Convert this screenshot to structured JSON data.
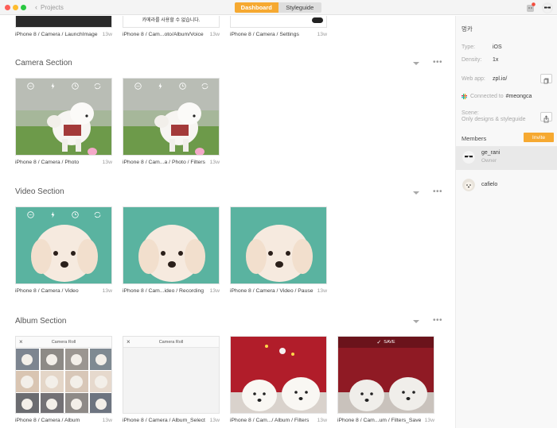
{
  "titlebar": {
    "back_label": "Projects",
    "tabs": [
      "Dashboard",
      "Styleguide"
    ],
    "active_tab": "Dashboard",
    "accent": "#f6a931"
  },
  "partial_row": [
    {
      "name": "iPhone 8 / Camera / LaunchImage",
      "time": "13w"
    },
    {
      "name": "iPhone 8 / Cam...oto/Album/Voice",
      "time": "13w",
      "overlay_text": "카메라를 사용할 수 없습니다."
    },
    {
      "name": "iPhone 8 / Camera / Settings",
      "time": "13w"
    }
  ],
  "sections": [
    {
      "title": "Camera Section",
      "cards": [
        {
          "name": "iPhone 8 / Camera / Photo",
          "time": "13w"
        },
        {
          "name": "iPhone 8 / Cam...a / Photo / Filters",
          "time": "13w"
        }
      ]
    },
    {
      "title": "Video Section",
      "cards": [
        {
          "name": "iPhone 8 / Camera / Video",
          "time": "13w"
        },
        {
          "name": "iPhone 8 / Cam...ideo / Recording",
          "time": "13w"
        },
        {
          "name": "iPhone 8 / Camera / Video / Pause",
          "time": "13w"
        }
      ]
    },
    {
      "title": "Album Section",
      "cards": [
        {
          "name": "iPhone 8 / Camera / Album",
          "time": "13w",
          "header": "Camera Roll"
        },
        {
          "name": "iPhone 8 / Camera / Album_Select",
          "time": "13w",
          "header": "Camera Roll"
        },
        {
          "name": "iPhone 8 / Cam.../ Album / Filters",
          "time": "13w"
        },
        {
          "name": "iPhone 8 / Cam...um / Filters_Save",
          "time": "13w",
          "header": "SAVE"
        }
      ]
    }
  ],
  "sidebar": {
    "project_name": "멍카",
    "type_label": "Type:",
    "type_value": "iOS",
    "density_label": "Density:",
    "density_value": "1x",
    "webapp_label": "Web app:",
    "webapp_value": "zpl.io/",
    "connected_prefix": "Connected to",
    "connected_channel": "#meongca",
    "scene_label": "Scene:",
    "scene_value": "Only designs & styleguide",
    "members_label": "Members",
    "invite_label": "Invite",
    "members": [
      {
        "name": "ge_rani",
        "role": "Owner"
      },
      {
        "name": "cafielo",
        "role": ""
      }
    ]
  }
}
